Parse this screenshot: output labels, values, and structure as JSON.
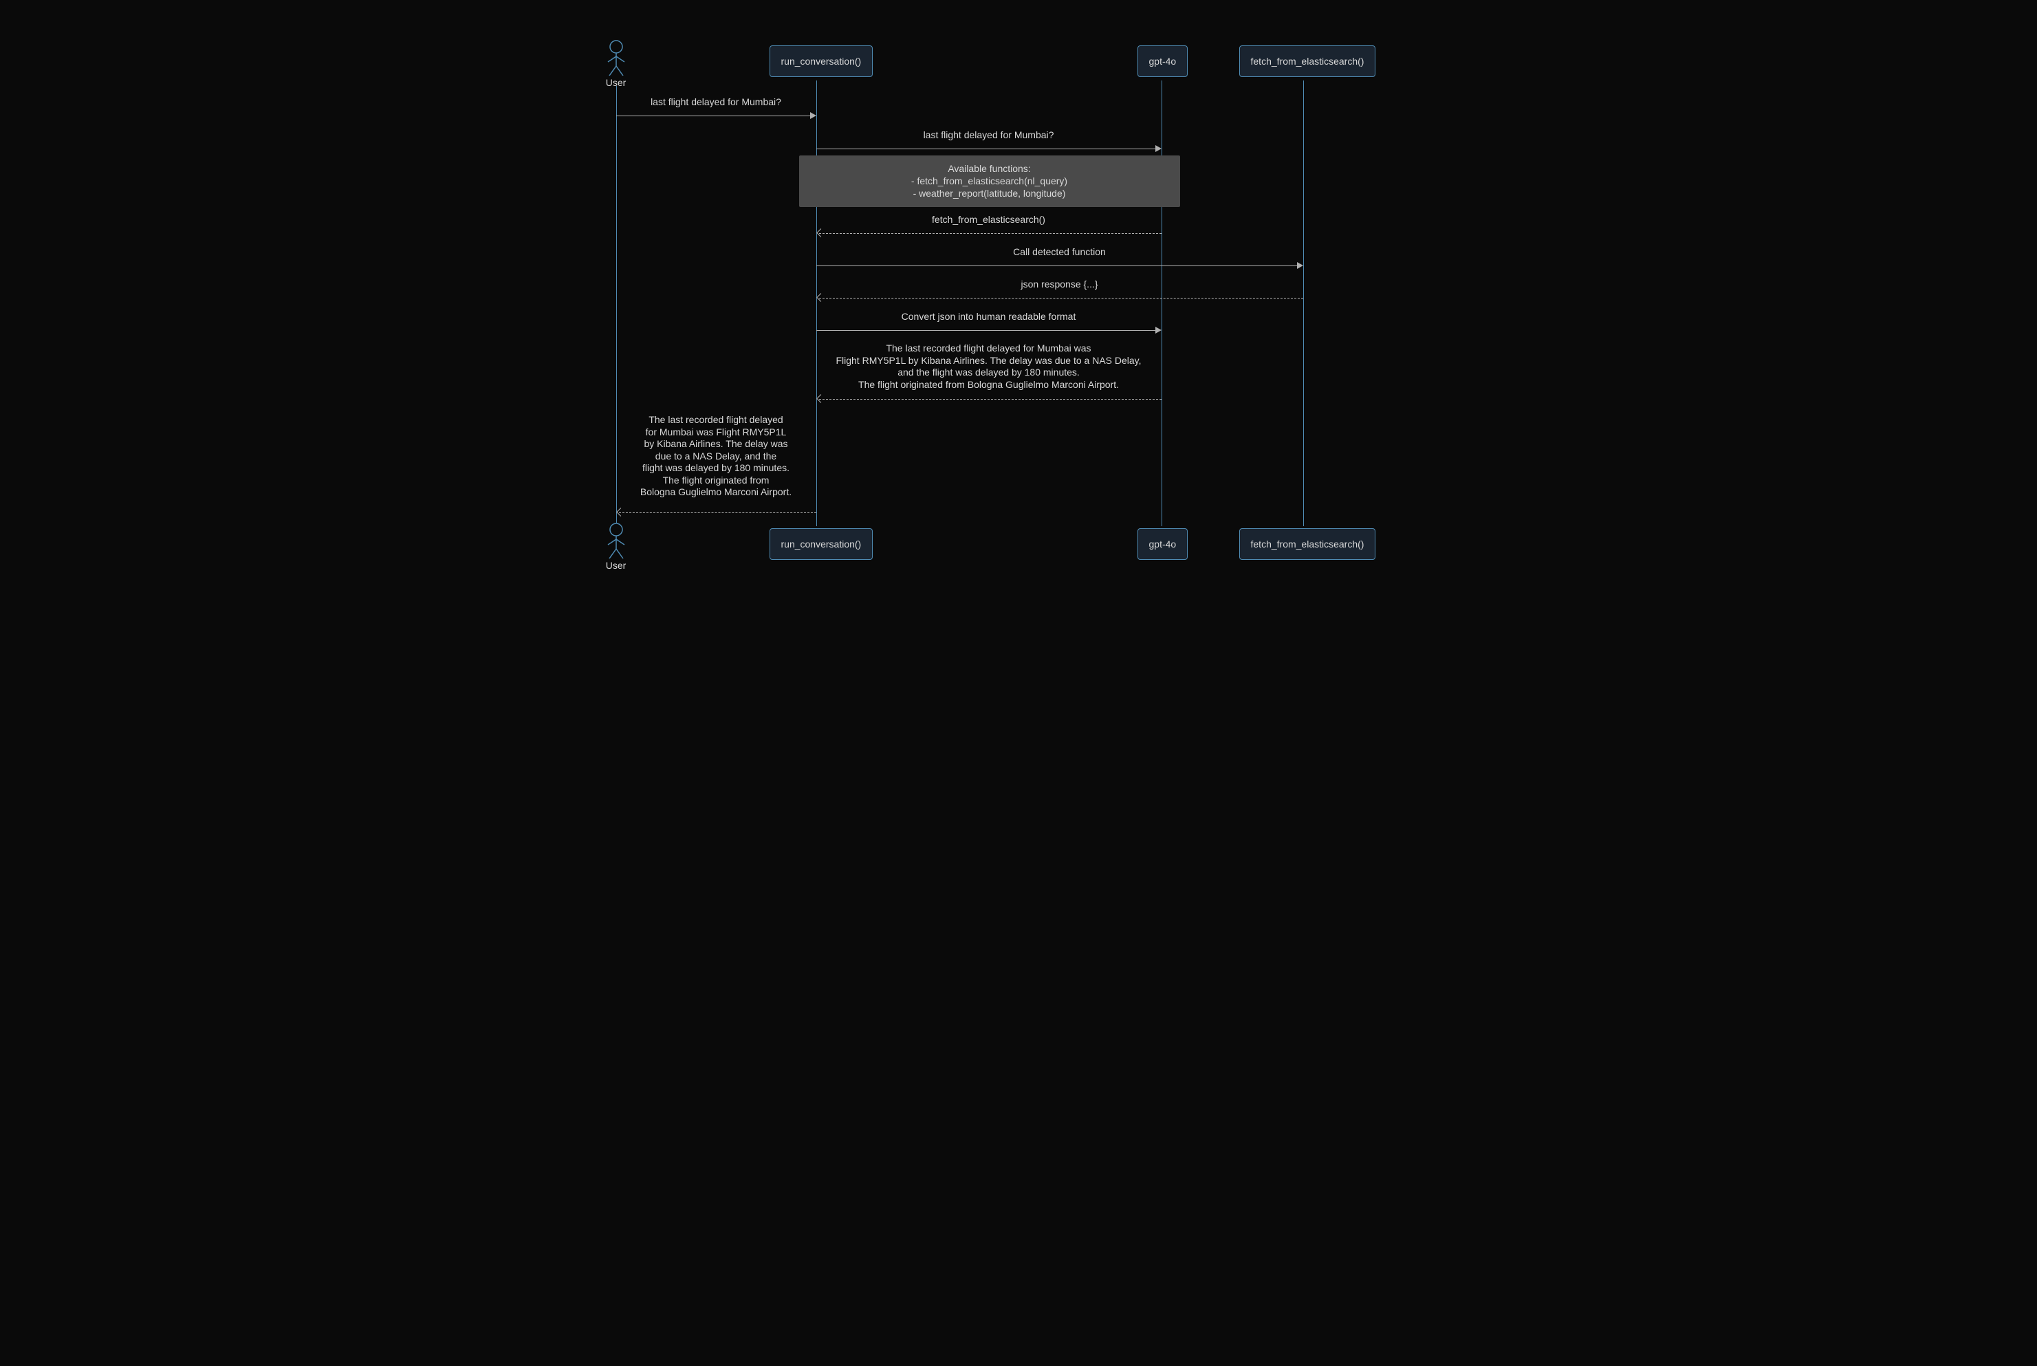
{
  "participants": {
    "user": "User",
    "run_conversation": "run_conversation()",
    "gpt4o": "gpt-4o",
    "fetch_es": "fetch_from_elasticsearch()"
  },
  "messages": {
    "m1": "last flight delayed for Mumbai?",
    "m2": "last flight delayed for Mumbai?",
    "note1_line1": "Available functions:",
    "note1_line2": "- fetch_from_elasticsearch(nl_query)",
    "note1_line3": "- weather_report(latitude, longitude)",
    "m3": "fetch_from_elasticsearch()",
    "m4": "Call detected function",
    "m5": "json response {...}",
    "m6": "Convert json into human readable format",
    "m7_line1": "The last recorded flight delayed for Mumbai was",
    "m7_line2": "Flight RMY5P1L by Kibana Airlines. The delay was due to a NAS Delay,",
    "m7_line3": "and the flight was delayed by 180 minutes.",
    "m7_line4": "The flight originated from Bologna Guglielmo Marconi Airport.",
    "m8_line1": "The last recorded flight delayed",
    "m8_line2": "for Mumbai was Flight RMY5P1L",
    "m8_line3": "by Kibana Airlines. The delay was",
    "m8_line4": "due to a NAS Delay, and the",
    "m8_line5": "flight was delayed by 180 minutes.",
    "m8_line6": "The flight originated from",
    "m8_line7": "Bologna Guglielmo Marconi Airport."
  },
  "chart_data": {
    "type": "sequence_diagram",
    "participants": [
      "User",
      "run_conversation()",
      "gpt-4o",
      "fetch_from_elasticsearch()"
    ],
    "interactions": [
      {
        "from": "User",
        "to": "run_conversation()",
        "label": "last flight delayed for Mumbai?",
        "style": "solid"
      },
      {
        "from": "run_conversation()",
        "to": "gpt-4o",
        "label": "last flight delayed for Mumbai?",
        "style": "solid"
      },
      {
        "note_over": [
          "run_conversation()",
          "gpt-4o"
        ],
        "text": "Available functions:\n- fetch_from_elasticsearch(nl_query)\n- weather_report(latitude, longitude)"
      },
      {
        "from": "gpt-4o",
        "to": "run_conversation()",
        "label": "fetch_from_elasticsearch()",
        "style": "dashed"
      },
      {
        "from": "run_conversation()",
        "to": "fetch_from_elasticsearch()",
        "label": "Call detected function",
        "style": "solid"
      },
      {
        "from": "fetch_from_elasticsearch()",
        "to": "run_conversation()",
        "label": "json response {...}",
        "style": "dashed"
      },
      {
        "from": "run_conversation()",
        "to": "gpt-4o",
        "label": "Convert json into human readable format",
        "style": "solid"
      },
      {
        "from": "gpt-4o",
        "to": "run_conversation()",
        "label": "The last recorded flight delayed for Mumbai was Flight RMY5P1L by Kibana Airlines. The delay was due to a NAS Delay, and the flight was delayed by 180 minutes. The flight originated from Bologna Guglielmo Marconi Airport.",
        "style": "dashed"
      },
      {
        "from": "run_conversation()",
        "to": "User",
        "label": "The last recorded flight delayed for Mumbai was Flight RMY5P1L by Kibana Airlines. The delay was due to a NAS Delay, and the flight was delayed by 180 minutes. The flight originated from Bologna Guglielmo Marconi Airport.",
        "style": "dashed"
      }
    ]
  }
}
